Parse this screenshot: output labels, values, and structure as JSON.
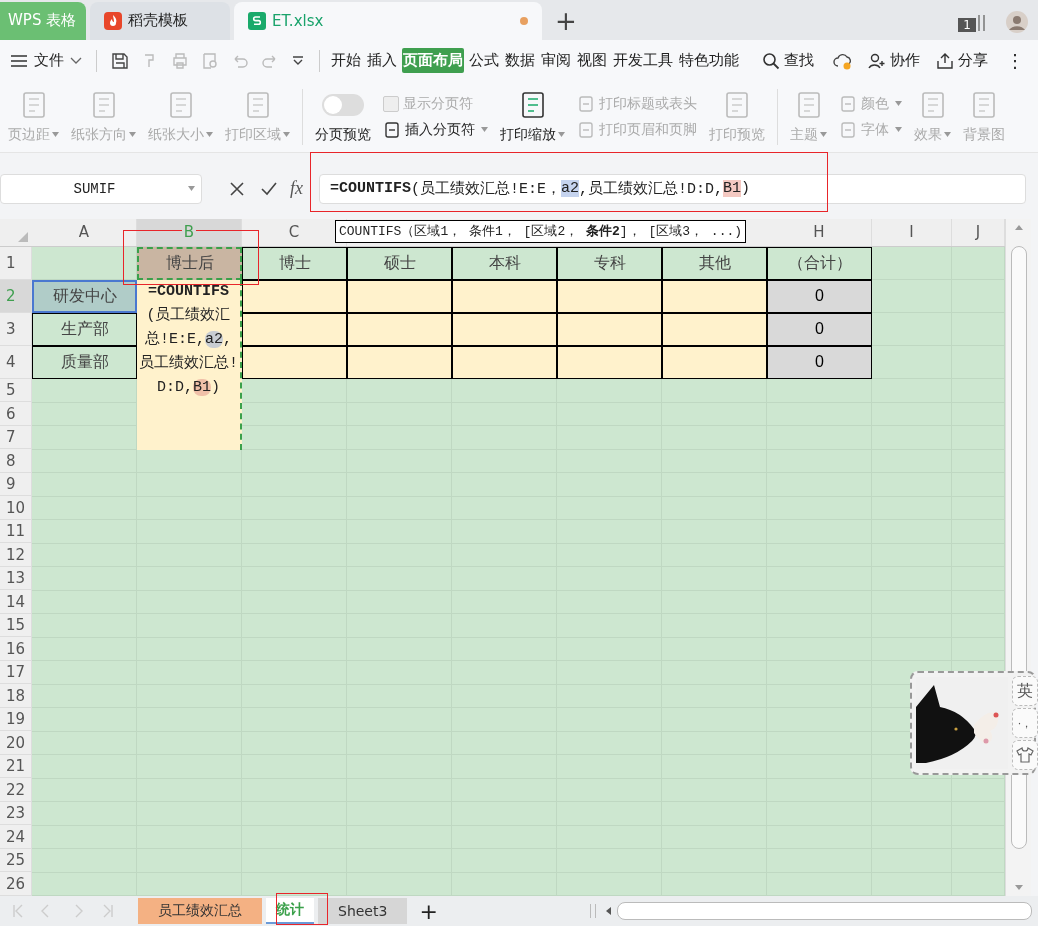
{
  "title_tabs": [
    {
      "label": "WPS 表格",
      "kind": "home",
      "selected": false
    },
    {
      "label": "稻壳模板",
      "kind": "docer",
      "selected": false
    },
    {
      "label": "ET.xlsx",
      "kind": "document",
      "selected": true,
      "modified": true
    }
  ],
  "new_tab": "+",
  "window_count": "1",
  "menu": {
    "file": "文件",
    "tabs": [
      {
        "label": "开始",
        "selected": false
      },
      {
        "label": "插入",
        "selected": false
      },
      {
        "label": "页面布局",
        "selected": true
      },
      {
        "label": "公式",
        "selected": false
      },
      {
        "label": "数据",
        "selected": false
      },
      {
        "label": "审阅",
        "selected": false
      },
      {
        "label": "视图",
        "selected": false
      },
      {
        "label": "开发工具",
        "selected": false
      },
      {
        "label": "特色功能",
        "selected": false
      }
    ],
    "search": "查找",
    "collaborate": "协作",
    "share": "分享",
    "more": "⋮"
  },
  "ribbon": [
    [
      {
        "items": [
          {
            "label": "页边距",
            "kind": "large",
            "disabled": true,
            "dropdown": true
          }
        ]
      },
      {
        "items": [
          {
            "label": "纸张方向",
            "kind": "large",
            "disabled": true,
            "dropdown": true
          }
        ]
      },
      {
        "items": [
          {
            "label": "纸张大小",
            "kind": "large",
            "disabled": true,
            "dropdown": true
          }
        ]
      },
      {
        "items": [
          {
            "label": "打印区域",
            "kind": "large",
            "disabled": true,
            "dropdown": true
          }
        ]
      }
    ],
    [
      {
        "items": [
          {
            "label": "分页预览",
            "kind": "toggle",
            "disabled": false,
            "on": false
          }
        ]
      },
      {
        "items": [
          {
            "label": "显示分页符",
            "kind": "check",
            "disabled": true,
            "checked": false
          },
          {
            "label": "插入分页符",
            "kind": "small",
            "disabled": false,
            "dropdown": true
          }
        ]
      },
      {
        "items": [
          {
            "label": "打印缩放",
            "kind": "large",
            "disabled": false,
            "dropdown": true
          }
        ]
      },
      {
        "items": [
          {
            "label": "打印标题或表头",
            "kind": "small",
            "disabled": true
          },
          {
            "label": "打印页眉和页脚",
            "kind": "small",
            "disabled": true
          }
        ]
      },
      {
        "items": [
          {
            "label": "打印预览",
            "kind": "large",
            "disabled": true
          }
        ]
      }
    ],
    [
      {
        "items": [
          {
            "label": "主题",
            "kind": "large",
            "disabled": true,
            "dropdown": true
          }
        ]
      },
      {
        "items": [
          {
            "label": "颜色",
            "kind": "small",
            "disabled": true,
            "dropdown": true
          },
          {
            "label": "字体",
            "kind": "small",
            "disabled": true,
            "dropdown": true
          }
        ]
      },
      {
        "items": [
          {
            "label": "效果",
            "kind": "large",
            "disabled": true,
            "dropdown": true
          }
        ]
      },
      {
        "items": [
          {
            "label": "背景图",
            "kind": "large",
            "disabled": true
          }
        ]
      }
    ]
  ],
  "formula_bar": {
    "name_box": "SUMIF",
    "fx": "fx",
    "segments": [
      {
        "text": "=COUNTIFS",
        "kind": "function"
      },
      {
        "text": "(员工绩效汇总!E:E，",
        "kind": "plain"
      },
      {
        "text": "a2",
        "kind": "ref"
      },
      {
        "text": ",员工绩效汇总!D:D,",
        "kind": "plain"
      },
      {
        "text": "B1",
        "kind": "ref"
      },
      {
        "text": ")",
        "kind": "plain"
      }
    ]
  },
  "tooltip": "COUNTIFS（区域1， 条件1， [区域2， **条件2**]， [区域3， ...)",
  "column_headers": [
    {
      "label": "A",
      "selected": false
    },
    {
      "label": "B",
      "selected": true
    },
    {
      "label": "C",
      "selected": false
    },
    {
      "label": "H",
      "selected": false
    },
    {
      "label": "I",
      "selected": false
    },
    {
      "label": "J",
      "selected": false
    }
  ],
  "rows": [
    {
      "label": "1",
      "selected": false,
      "cells": [
        {
          "kind": "blank"
        },
        {
          "kind": "ref-heading",
          "text": "博士后"
        },
        {
          "kind": "heading",
          "text": "博士"
        },
        {
          "kind": "heading",
          "text": "硕士"
        },
        {
          "kind": "heading",
          "text": "本科"
        },
        {
          "kind": "heading",
          "text": "专科"
        },
        {
          "kind": "heading",
          "text": "其他"
        },
        {
          "kind": "heading",
          "text": "（合计）"
        }
      ]
    },
    {
      "label": "2",
      "selected": true,
      "cells": [
        {
          "kind": "ref-label",
          "text": "研发中心"
        },
        {
          "kind": "blank"
        },
        {
          "kind": "input"
        },
        {
          "kind": "input"
        },
        {
          "kind": "input"
        },
        {
          "kind": "input"
        },
        {
          "kind": "input"
        },
        {
          "kind": "total",
          "text": "0"
        }
      ]
    },
    {
      "label": "3",
      "selected": false,
      "cells": [
        {
          "kind": "label",
          "text": "生产部"
        },
        {
          "kind": "blank"
        },
        {
          "kind": "input"
        },
        {
          "kind": "input"
        },
        {
          "kind": "input"
        },
        {
          "kind": "input"
        },
        {
          "kind": "input"
        },
        {
          "kind": "total",
          "text": "0"
        }
      ]
    },
    {
      "label": "4",
      "selected": false,
      "cells": [
        {
          "kind": "label",
          "text": "质量部"
        },
        {
          "kind": "blank"
        },
        {
          "kind": "input"
        },
        {
          "kind": "input"
        },
        {
          "kind": "input"
        },
        {
          "kind": "input"
        },
        {
          "kind": "input"
        },
        {
          "kind": "total",
          "text": "0"
        }
      ]
    },
    {
      "label": "5",
      "selected": false
    },
    {
      "label": "6",
      "selected": false
    },
    {
      "label": "7",
      "selected": false
    },
    {
      "label": "8",
      "selected": false
    },
    {
      "label": "9",
      "selected": false
    },
    {
      "label": "10",
      "selected": false
    },
    {
      "label": "11",
      "selected": false
    },
    {
      "label": "12",
      "selected": false
    },
    {
      "label": "13",
      "selected": false
    },
    {
      "label": "14",
      "selected": false
    },
    {
      "label": "15",
      "selected": false
    },
    {
      "label": "16",
      "selected": false
    },
    {
      "label": "17",
      "selected": false
    },
    {
      "label": "18",
      "selected": false
    },
    {
      "label": "19",
      "selected": false
    },
    {
      "label": "20",
      "selected": false
    },
    {
      "label": "21",
      "selected": false
    },
    {
      "label": "22",
      "selected": false
    },
    {
      "label": "23",
      "selected": false
    },
    {
      "label": "24",
      "selected": false
    },
    {
      "label": "25",
      "selected": false
    },
    {
      "label": "26",
      "selected": false
    }
  ],
  "cell_editor": {
    "segments": [
      {
        "text": "=COUNTIFS",
        "kind": "function"
      },
      {
        "text": "(员工绩效汇总!E:E,",
        "kind": "plain"
      },
      {
        "text": "a2",
        "kind": "ref"
      },
      {
        "text": ",员工绩效汇总!D:D,",
        "kind": "plain"
      },
      {
        "text": "B1",
        "kind": "ref"
      },
      {
        "text": ")",
        "kind": "plain"
      }
    ]
  },
  "sheet_tabs": [
    {
      "label": "员工绩效汇总",
      "selected": false,
      "kind": "colored"
    },
    {
      "label": "统计",
      "selected": true,
      "kind": "plain"
    },
    {
      "label": "Sheet3",
      "selected": false,
      "kind": "plain"
    }
  ],
  "add_sheet": "+",
  "ime": {
    "kind": "picture",
    "mode": "英",
    "punctuation": "·，"
  },
  "highlight_frames": [
    {
      "kind": "formula-bar"
    },
    {
      "kind": "cell"
    },
    {
      "kind": "sheet-tab"
    }
  ]
}
